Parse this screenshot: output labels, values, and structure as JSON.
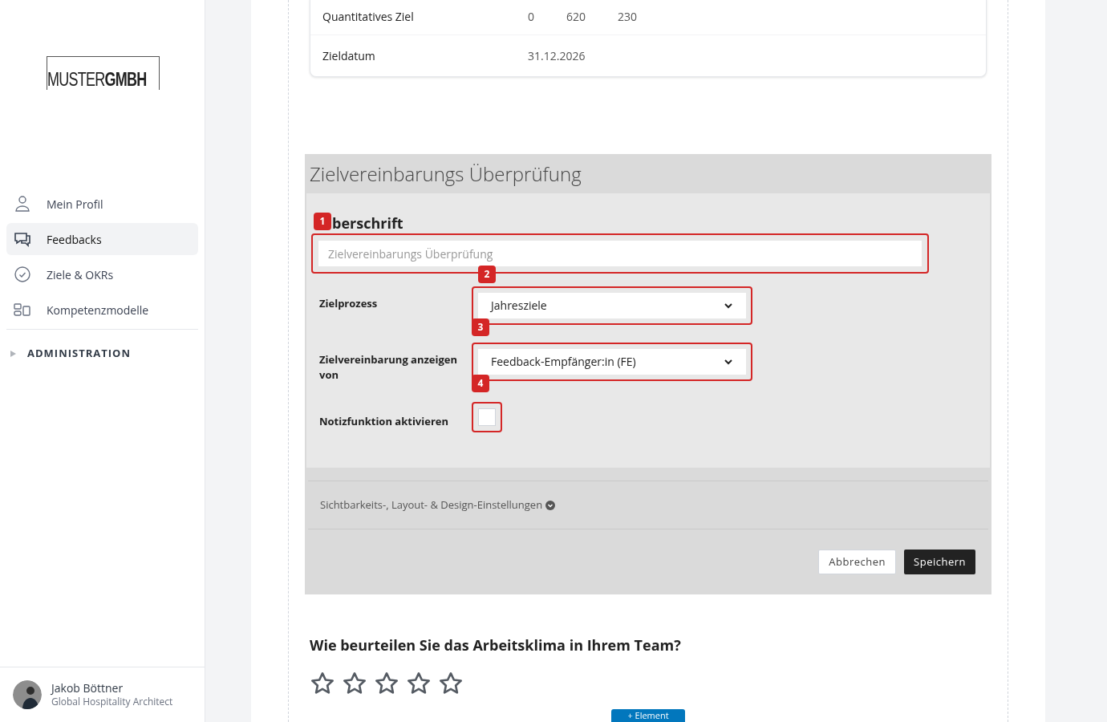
{
  "logo": {
    "light": "MUSTER",
    "bold": "GMBH"
  },
  "nav": [
    {
      "label": "Mein Profil",
      "kind": "user",
      "selected": false
    },
    {
      "label": "Feedbacks",
      "kind": "chat",
      "selected": true
    },
    {
      "label": "Ziele & OKRs",
      "kind": "check",
      "selected": false
    },
    {
      "label": "Kompetenzmodelle",
      "kind": "blocks",
      "selected": false
    }
  ],
  "admin": {
    "label": "ADMINISTRATION",
    "expanded": false
  },
  "user": {
    "name": "Jakob Böttner",
    "role": "Global Hospitality Architect"
  },
  "goal_card": {
    "rows": [
      {
        "label": "Quantitatives Ziel",
        "values": [
          "0",
          "620",
          "230"
        ]
      },
      {
        "label": "Zieldatum",
        "values": [
          "31.12.2026"
        ]
      }
    ]
  },
  "editor": {
    "title": "Zielvereinbarungs Überprüfung",
    "heading_label": "berschrift",
    "heading_placeholder": "Zielvereinbarungs Überprüfung",
    "fields": [
      {
        "kind": "select",
        "label": "Zielprozess",
        "value": "Jahresziele"
      },
      {
        "kind": "select",
        "label": "Zielvereinbarung anzeigen von",
        "value": "Feedback-Empfänger:in (FE)"
      },
      {
        "kind": "checkbox",
        "label": "Notizfunktion aktivieren",
        "checked": false
      }
    ],
    "settings_link": "Sichtbarkeits-, Layout- & Design-Einstellungen",
    "buttons": [
      {
        "label": "Abbrechen",
        "kind": "secondary"
      },
      {
        "label": "Speichern",
        "kind": "primary"
      }
    ]
  },
  "annotations": [
    "1",
    "2",
    "3",
    "4"
  ],
  "question": {
    "text": "Wie beurteilen Sie das Arbeitsklima in Ihrem Team?",
    "stars": 0
  },
  "add_button": "+ Element"
}
